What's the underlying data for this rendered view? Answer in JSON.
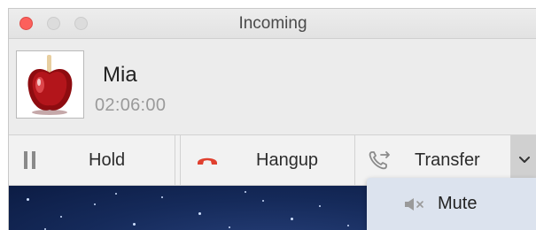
{
  "window": {
    "title": "Incoming"
  },
  "caller": {
    "name": "Mia",
    "duration": "02:06:00",
    "avatar_icon": "candy-apple-icon"
  },
  "toolbar": {
    "hold_label": "Hold",
    "hold_icon": "pause-icon",
    "hangup_label": "Hangup",
    "hangup_icon": "phone-hangup-icon",
    "transfer_label": "Transfer",
    "transfer_icon": "phone-transfer-icon",
    "dropdown_icon": "chevron-down-icon"
  },
  "menu": {
    "mute_label": "Mute",
    "mute_icon": "speaker-muted-icon"
  },
  "colors": {
    "close": "#fc605c",
    "hangup_icon": "#e0402f",
    "menu_bg": "#dce3ee",
    "background_dark": "#152a5a"
  }
}
